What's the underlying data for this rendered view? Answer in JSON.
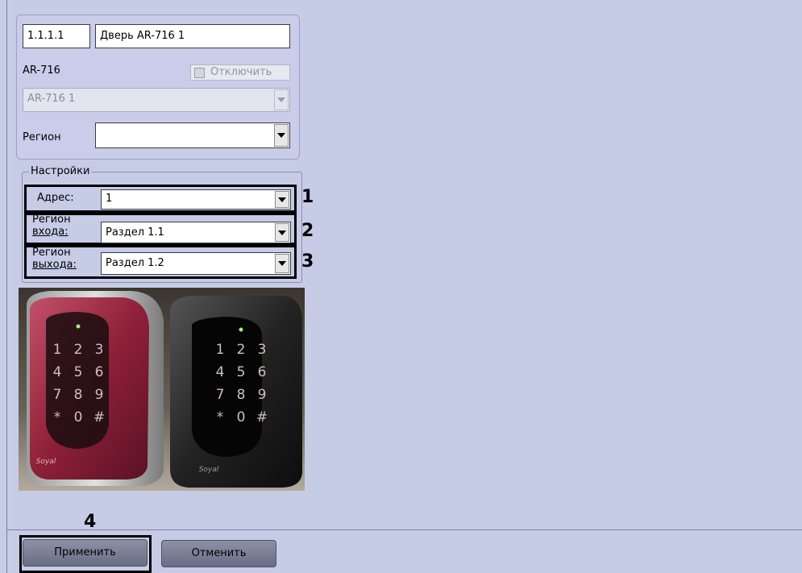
{
  "header": {
    "id_value": "1.1.1.1",
    "name_value": "Дверь AR-716 1"
  },
  "device": {
    "model_label": "AR-716",
    "disable_label": "Отключить",
    "disable_checked": false,
    "reader_value": "AR-716 1",
    "region_label": "Регион",
    "region_value": ""
  },
  "settings": {
    "title": "Настройки",
    "address_label": "Адрес:",
    "address_value": "1",
    "entry_label_line1": "Регион",
    "entry_label_line2": "входа:",
    "entry_value": "Раздел 1.1",
    "exit_label_line1": "Регион",
    "exit_label_line2": "выхода:",
    "exit_value": "Раздел 1.2"
  },
  "keypad": {
    "keys": [
      "1",
      "2",
      "3",
      "4",
      "5",
      "6",
      "7",
      "8",
      "9",
      "*",
      "0",
      "#"
    ],
    "brand": "Soyal"
  },
  "callouts": {
    "c1": "1",
    "c2": "2",
    "c3": "3",
    "c4": "4"
  },
  "footer": {
    "apply_label": "Применить",
    "cancel_label": "Отменить"
  }
}
